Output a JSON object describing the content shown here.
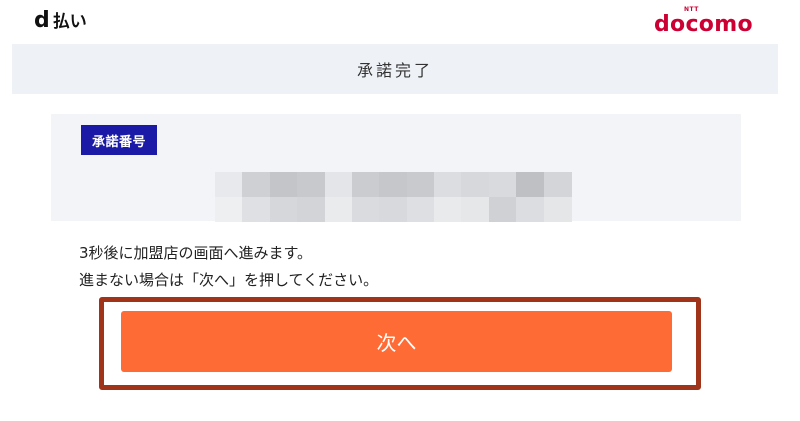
{
  "header": {
    "dpay_logo": {
      "mark": "d",
      "text": "払い"
    },
    "docomo_logo": {
      "ntt": "NTT",
      "word": "docomo"
    }
  },
  "title": "承諾完了",
  "approval": {
    "badge": "承諾番号"
  },
  "message": {
    "line1": "3秒後に加盟店の画面へ進みます。",
    "line2": "進まない場合は「次へ」を押してください。"
  },
  "next_button": {
    "label": "次へ"
  },
  "colors": {
    "brand_red": "#cc0033",
    "badge_blue": "#1a1aa6",
    "button_orange": "#ff6b35",
    "highlight_frame": "#a0341a",
    "panel_bg": "#eef2f7"
  }
}
